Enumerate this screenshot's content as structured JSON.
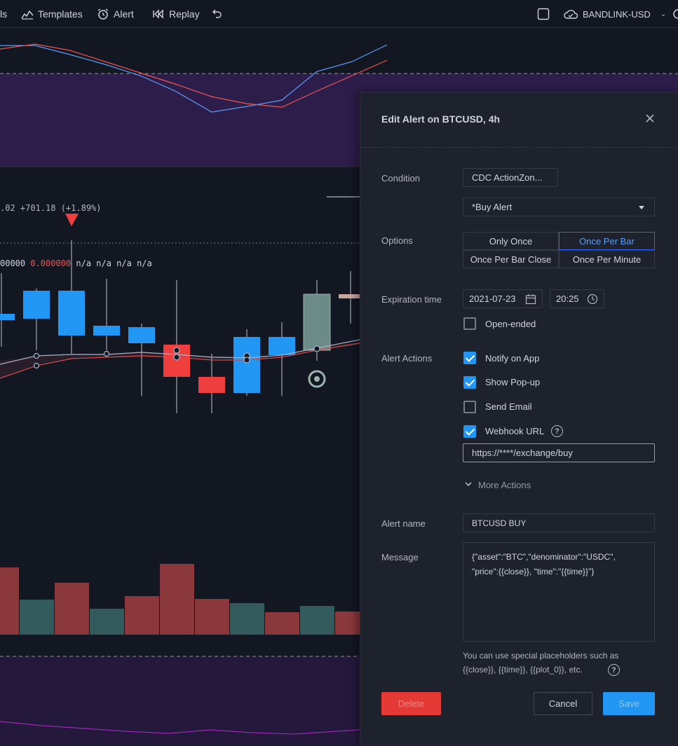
{
  "toolbar": {
    "partial_label": "ls",
    "templates_label": "Templates",
    "alert_label": "Alert",
    "replay_label": "Replay",
    "account_label": "BANDLINK-USD"
  },
  "chart": {
    "price_change": ".02 +701.18 (+1.89%)",
    "indicator_values": "00000",
    "indicator_red_value": "0.000000",
    "indicator_na": "n/a n/a n/a n/a"
  },
  "colors": {
    "up_candle": "#2196f3",
    "down_candle": "#ef3e3e",
    "stoch_band": "#2c1d4a",
    "dialog_bg": "#1e222d",
    "accent": "#2962ff",
    "delete_button": "#e53935",
    "save_button": "#2196f3"
  },
  "dialog": {
    "title": "Edit Alert on BTCUSD, 4h",
    "close_icon": "close-icon",
    "condition": {
      "label": "Condition",
      "indicator": "CDC ActionZon...",
      "alert": "*Buy Alert"
    },
    "options": {
      "label": "Options",
      "choices": [
        "Only Once",
        "Once Per Bar",
        "Once Per Bar Close",
        "Once Per Minute"
      ],
      "selected": "Once Per Bar"
    },
    "expiration": {
      "label": "Expiration time",
      "date": "2021-07-23",
      "time": "20:25",
      "open_ended_label": "Open-ended",
      "open_ended": false
    },
    "actions": {
      "label": "Alert Actions",
      "items": [
        {
          "label": "Notify on App",
          "checked": true
        },
        {
          "label": "Show Pop-up",
          "checked": true
        },
        {
          "label": "Send Email",
          "checked": false
        },
        {
          "label": "Webhook URL",
          "checked": true
        }
      ],
      "webhook_url": "https://****/exchange/buy",
      "more_actions_label": "More Actions"
    },
    "alert_name": {
      "label": "Alert name",
      "value": "BTCUSD BUY"
    },
    "message": {
      "label": "Message",
      "value": "{\"asset\":\"BTC\",\"denominator\":\"USDC\",\n\"price\":{{close}}, \"time\":\"{{time}}\"}"
    },
    "hint_line1": "You can use special placeholders such as",
    "hint_line2": "{{close}}, {{time}}, {{plot_0}}, etc.",
    "delete_label": "Delete",
    "cancel_label": "Cancel",
    "save_label": "Save"
  }
}
